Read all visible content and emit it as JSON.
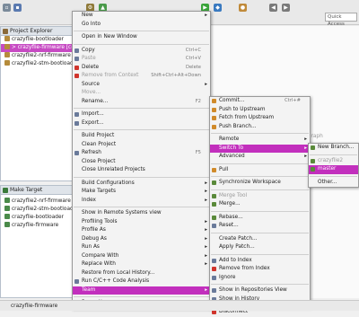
{
  "toolbar": {
    "quick_access_placeholder": "Quick Access"
  },
  "project_explorer": {
    "title": "Project Explorer",
    "items": [
      {
        "label": "crazyflie-bootloader",
        "selected": false
      },
      {
        "label": "> crazyflie-firmware [cra",
        "selected": true
      },
      {
        "label": "crazyflie2-nrf-firmware",
        "selected": false
      },
      {
        "label": "crazyflie2-stm-bootload",
        "selected": false
      }
    ]
  },
  "make_target": {
    "title": "Make Target",
    "items": [
      {
        "label": "crazyflie2-nrf-firmware"
      },
      {
        "label": "crazyflie2-stm-bootloader"
      },
      {
        "label": "crazyflie-bootloader"
      },
      {
        "label": "crazyflie-firmware"
      }
    ]
  },
  "context_menu": {
    "items": [
      {
        "label": "New",
        "submenu": true
      },
      {
        "label": "Go Into"
      },
      {
        "sep": true
      },
      {
        "label": "Open in New Window"
      },
      {
        "sep": true
      },
      {
        "label": "Copy",
        "accel": "Ctrl+C",
        "icon": "copy-icon"
      },
      {
        "label": "Paste",
        "accel": "Ctrl+V",
        "disabled": true,
        "icon": "paste-icon"
      },
      {
        "label": "Delete",
        "accel": "Delete",
        "icon": "delete-icon"
      },
      {
        "label": "Remove from Context",
        "accel": "Shift+Ctrl+Alt+Down",
        "disabled": true,
        "icon": "remove-context-icon"
      },
      {
        "label": "Source",
        "submenu": true
      },
      {
        "label": "Move...",
        "disabled": true
      },
      {
        "label": "Rename...",
        "accel": "F2"
      },
      {
        "sep": true
      },
      {
        "label": "Import...",
        "icon": "import-icon"
      },
      {
        "label": "Export...",
        "icon": "export-icon"
      },
      {
        "sep": true
      },
      {
        "label": "Build Project"
      },
      {
        "label": "Clean Project"
      },
      {
        "label": "Refresh",
        "accel": "F5",
        "icon": "refresh-icon"
      },
      {
        "label": "Close Project"
      },
      {
        "label": "Close Unrelated Projects"
      },
      {
        "sep": true
      },
      {
        "label": "Build Configurations",
        "submenu": true
      },
      {
        "label": "Make Targets",
        "submenu": true
      },
      {
        "label": "Index",
        "submenu": true
      },
      {
        "sep": true
      },
      {
        "label": "Show in Remote Systems view"
      },
      {
        "label": "Profiling Tools",
        "submenu": true
      },
      {
        "label": "Profile As",
        "submenu": true
      },
      {
        "label": "Debug As",
        "submenu": true
      },
      {
        "label": "Run As",
        "submenu": true
      },
      {
        "label": "Compare With",
        "submenu": true
      },
      {
        "label": "Replace With",
        "submenu": true
      },
      {
        "label": "Restore from Local History..."
      },
      {
        "label": "Run C/C++ Code Analysis",
        "icon": "code-analysis-icon"
      },
      {
        "label": "Team",
        "submenu": true,
        "highlighted": true
      },
      {
        "sep": true
      },
      {
        "label": "Properties",
        "accel": "Alt+Enter"
      }
    ]
  },
  "team_menu": {
    "items": [
      {
        "label": "Commit...",
        "accel": "Ctrl+#",
        "icon": "commit-icon"
      },
      {
        "label": "Push to Upstream",
        "icon": "push-icon"
      },
      {
        "label": "Fetch from Upstream",
        "icon": "fetch-icon"
      },
      {
        "label": "Push Branch...",
        "icon": "push-branch-icon"
      },
      {
        "sep": true
      },
      {
        "label": "Remote",
        "submenu": true
      },
      {
        "label": "Switch To",
        "submenu": true,
        "highlighted": true
      },
      {
        "label": "Advanced",
        "submenu": true
      },
      {
        "sep": true
      },
      {
        "label": "Pull",
        "icon": "pull-icon"
      },
      {
        "sep": true
      },
      {
        "label": "Synchronize Workspace",
        "icon": "sync-icon"
      },
      {
        "sep": true
      },
      {
        "label": "Merge Tool",
        "disabled": true,
        "icon": "merge-tool-icon"
      },
      {
        "label": "Merge...",
        "icon": "merge-icon"
      },
      {
        "sep": true
      },
      {
        "label": "Rebase...",
        "icon": "rebase-icon"
      },
      {
        "label": "Reset...",
        "icon": "reset-icon"
      },
      {
        "sep": true
      },
      {
        "label": "Create Patch..."
      },
      {
        "label": "Apply Patch..."
      },
      {
        "sep": true
      },
      {
        "label": "Add to Index",
        "icon": "add-index-icon"
      },
      {
        "label": "Remove from Index",
        "icon": "remove-index-icon"
      },
      {
        "label": "Ignore",
        "icon": "ignore-icon"
      },
      {
        "sep": true
      },
      {
        "label": "Show in Repositories View",
        "icon": "repo-view-icon"
      },
      {
        "label": "Show in History",
        "icon": "history-icon"
      },
      {
        "sep": true
      },
      {
        "label": "Disconnect",
        "icon": "disconnect-icon"
      }
    ]
  },
  "switch_menu": {
    "items": [
      {
        "label": "New Branch...",
        "icon": "new-branch-icon"
      },
      {
        "sep": true
      },
      {
        "label": "crazyflie2",
        "disabled": true,
        "icon": "branch-icon"
      },
      {
        "label": "master",
        "highlighted": true,
        "icon": "branch-icon"
      },
      {
        "sep": true
      },
      {
        "label": "Other..."
      }
    ]
  },
  "graph_label": "Graph",
  "status_bar": {
    "text": "crazyflie-firmware"
  },
  "colors": {
    "highlight": "#c22fbd",
    "selection": "#c74bc3"
  }
}
